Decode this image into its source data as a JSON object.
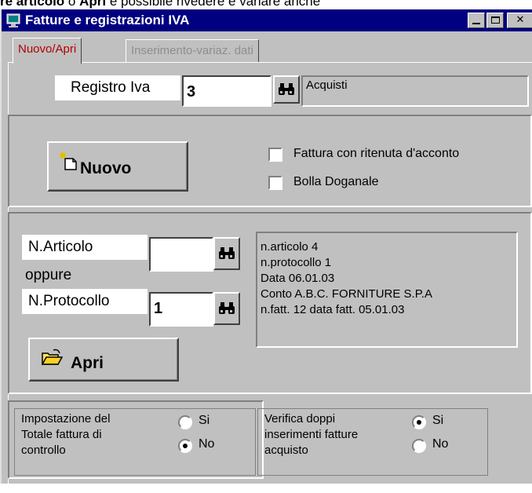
{
  "caption": {
    "pre": "",
    "bold1": "re articolo",
    "mid": " o ",
    "bold2": "Apri",
    "post": " è possibile rivedere e variare anche"
  },
  "window": {
    "title": "Fatture e registrazioni IVA",
    "controls": [
      "minimize-icon",
      "maximize-icon",
      "close-icon"
    ]
  },
  "tabs": [
    {
      "label": "Nuovo/Apri",
      "active": true
    },
    {
      "label": "Inserimento-variaz. dati",
      "active": false
    }
  ],
  "registro": {
    "label": "Registro Iva",
    "value": "3",
    "description": "Acquisti"
  },
  "nuovo": {
    "button_label": "Nuovo",
    "checkbox_ritenuta": "Fattura con ritenuta d'acconto",
    "checkbox_bolla": "Bolla Doganale"
  },
  "ricerca": {
    "label_articolo": "N.Articolo",
    "label_oppure": "oppure",
    "label_protocollo": "N.Protocollo",
    "articolo_value": "",
    "protocollo_value": "1",
    "info_lines": [
      "n.articolo    4",
      "n.protocollo 1",
      "Data   06.01.03",
      "Conto A.B.C. FORNITURE S.P.A",
      "n.fatt. 12 data fatt. 05.01.03"
    ],
    "apri_label": "Apri"
  },
  "impostazione": {
    "label_line1": "Impostazione del",
    "label_line2": "Totale fattura di",
    "label_line3": "controllo",
    "opt_si": "Si",
    "opt_no": "No",
    "selected": "No"
  },
  "verifica": {
    "label_line1": "Verifica doppi",
    "label_line2": "inserimenti fatture",
    "label_line3": "acquisto",
    "opt_si": "Si",
    "opt_no": "No",
    "selected": "Si"
  }
}
